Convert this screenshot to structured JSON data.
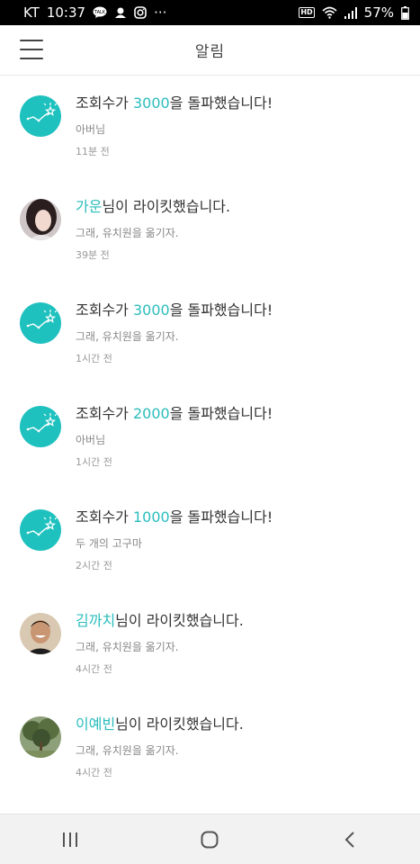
{
  "status_bar": {
    "carrier": "KT",
    "time": "10:37",
    "icons_left": [
      "talk-icon",
      "notification-icon",
      "instagram-icon",
      "more-icon"
    ],
    "overflow": "···",
    "hd_label": "HD",
    "battery": "57%"
  },
  "header": {
    "title": "알림",
    "menu_icon": "hamburger-menu-icon"
  },
  "notifications": [
    {
      "type": "views",
      "prefix": "조회수가 ",
      "highlight": "3000",
      "suffix": "을 돌파했습니다!",
      "sub": "아버님",
      "time": "11분 전"
    },
    {
      "type": "like",
      "prefix": "",
      "highlight": "가운",
      "suffix": "님이 라이킷했습니다.",
      "sub": "그래, 유치원을 옮기자.",
      "time": "39분 전"
    },
    {
      "type": "views",
      "prefix": "조회수가 ",
      "highlight": "3000",
      "suffix": "을 돌파했습니다!",
      "sub": "그래, 유치원을 옮기자.",
      "time": "1시간 전"
    },
    {
      "type": "views",
      "prefix": "조회수가 ",
      "highlight": "2000",
      "suffix": "을 돌파했습니다!",
      "sub": "아버님",
      "time": "1시간 전"
    },
    {
      "type": "views",
      "prefix": "조회수가 ",
      "highlight": "1000",
      "suffix": "을 돌파했습니다!",
      "sub": "두 개의 고구마",
      "time": "2시간 전"
    },
    {
      "type": "like",
      "prefix": "",
      "highlight": "김까치",
      "suffix": "님이 라이킷했습니다.",
      "sub": "그래, 유치원을 옮기자.",
      "time": "4시간 전"
    },
    {
      "type": "like",
      "prefix": "",
      "highlight": "이예빈",
      "suffix": "님이 라이킷했습니다.",
      "sub": "그래, 유치원을 옮기자.",
      "time": "4시간 전"
    }
  ],
  "nav_bar": {
    "recent_icon": "recent-apps-icon",
    "home_icon": "home-icon",
    "back_icon": "back-icon"
  },
  "colors": {
    "accent": "#2bbcbc",
    "views_avatar": "#1fc1bf"
  }
}
